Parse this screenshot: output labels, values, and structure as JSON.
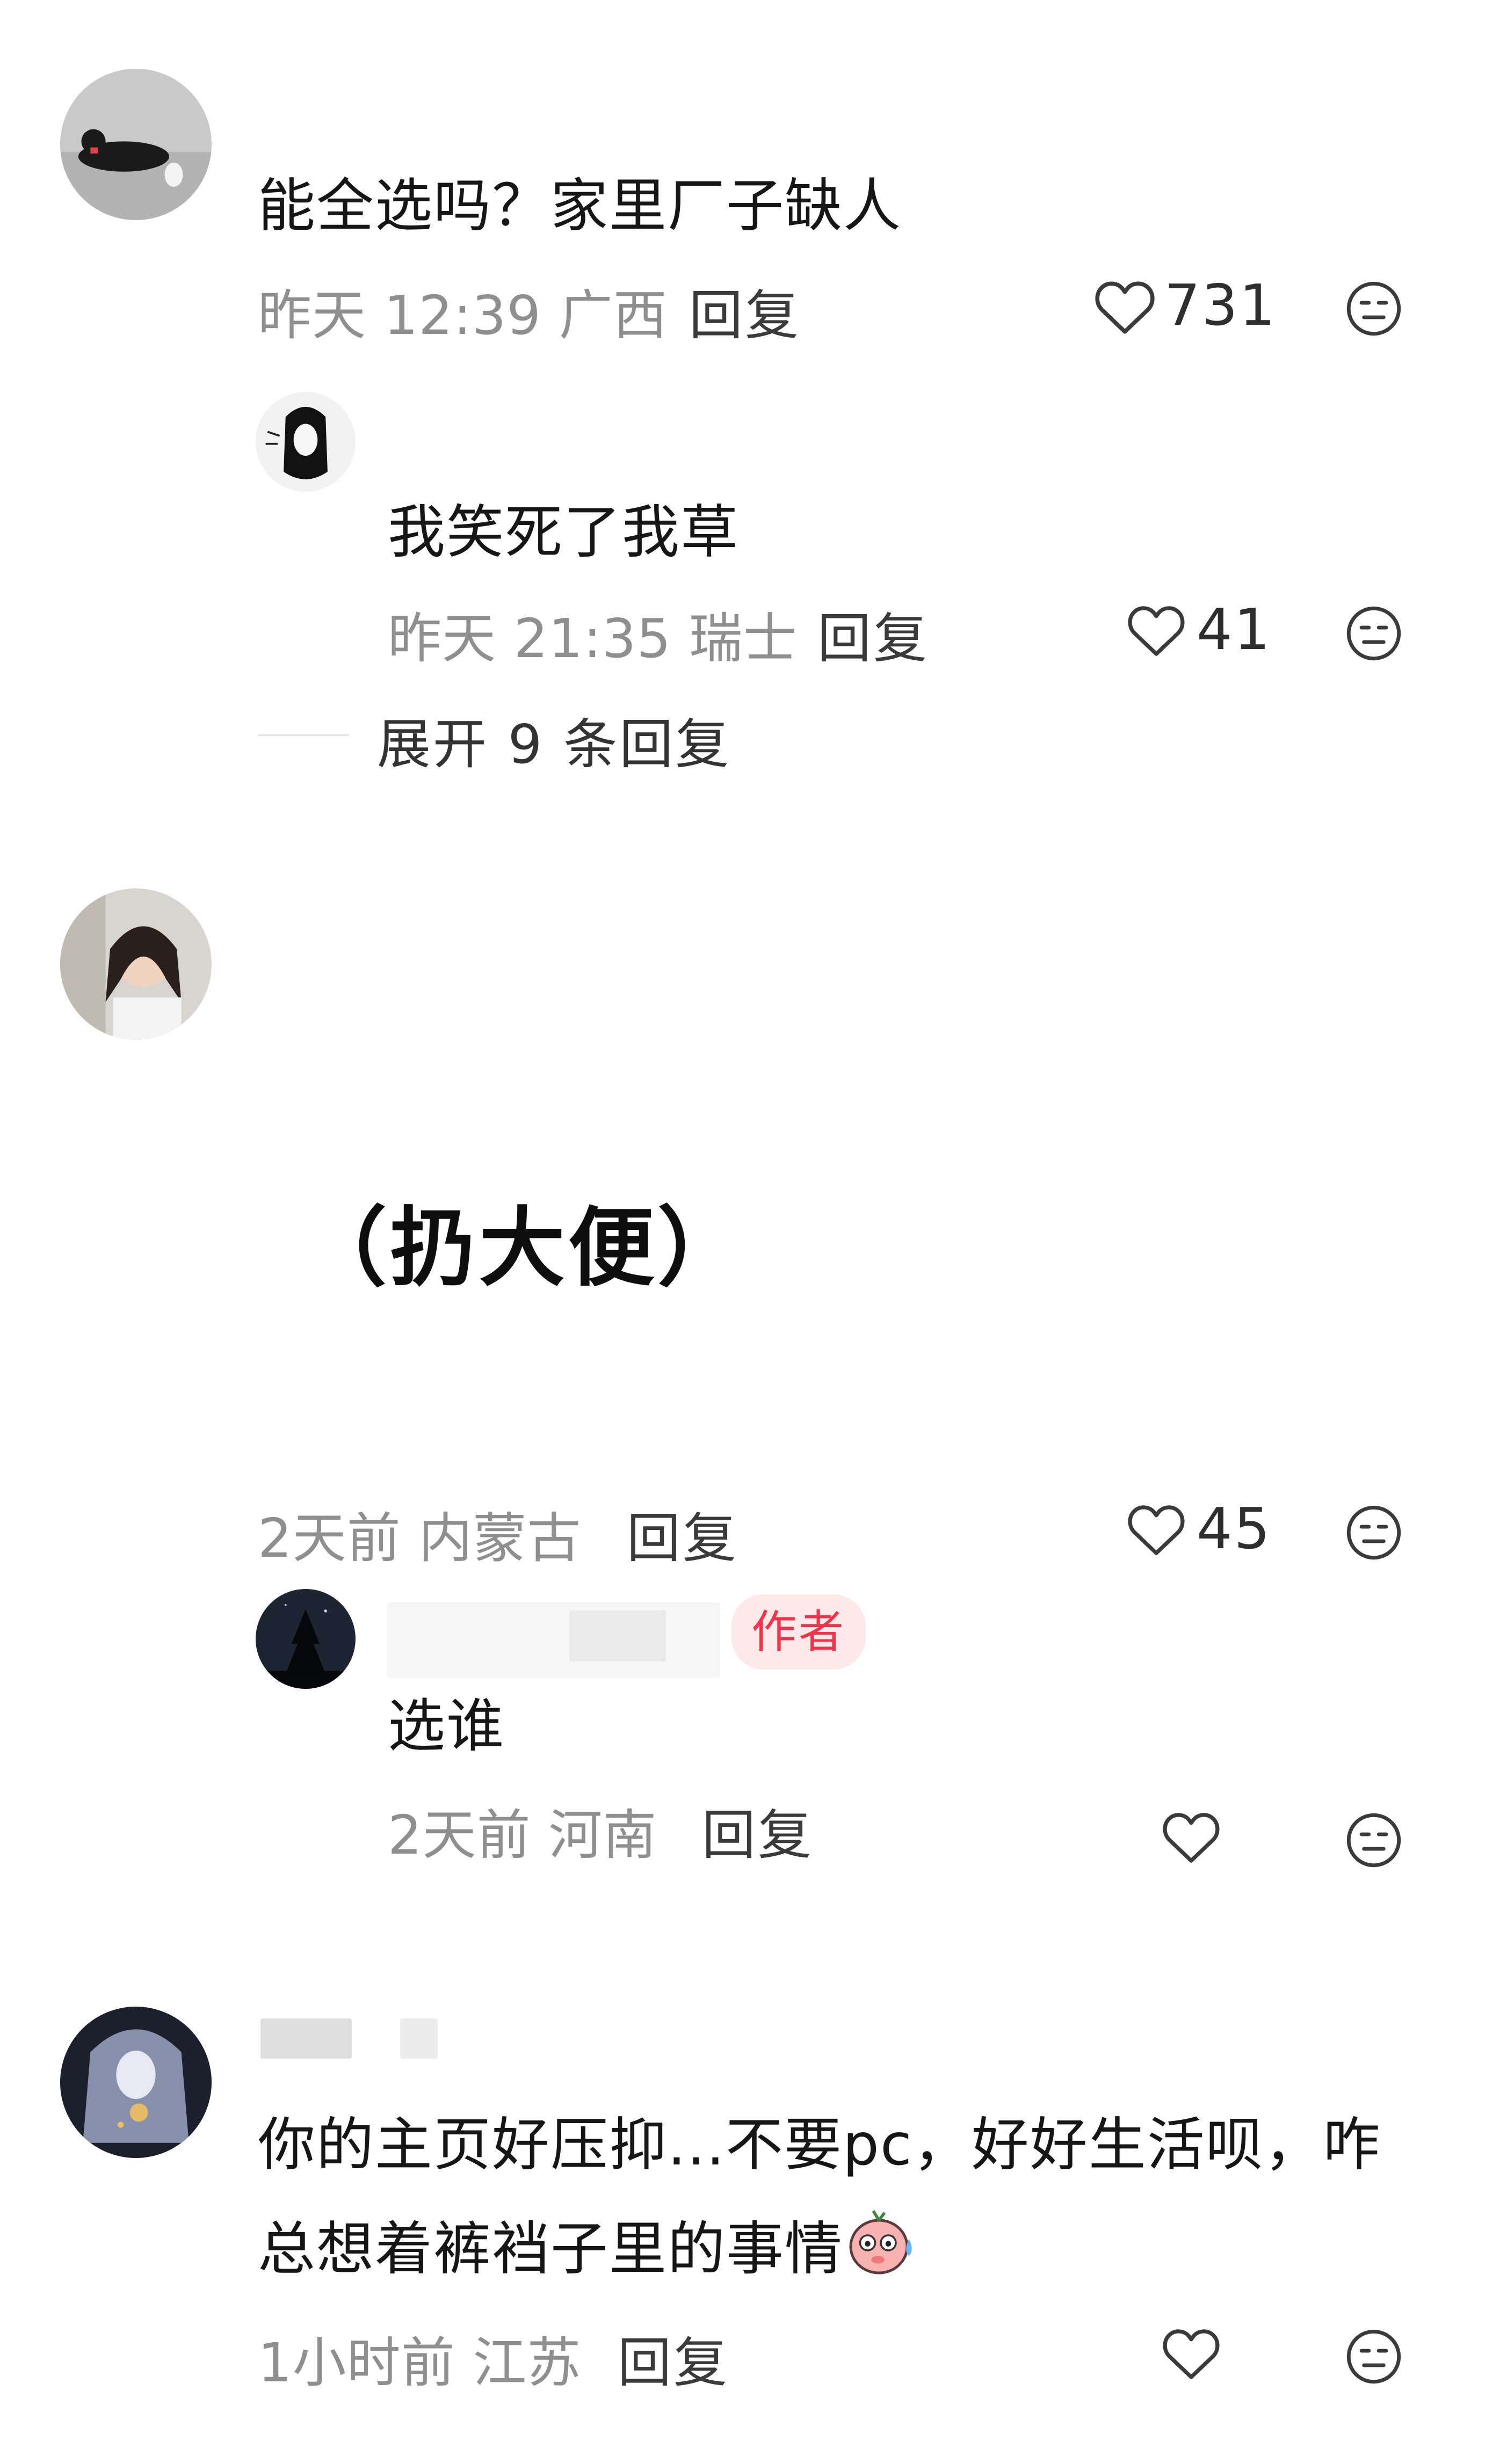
{
  "comments": [
    {
      "text": "能全选吗？家里厂子缺人",
      "time": "昨天 12:39",
      "location": "广西",
      "reply_label": "回复",
      "likes": "731",
      "sub_reply": {
        "text": "我笑死了我草",
        "time": "昨天 21:35",
        "location": "瑞士",
        "reply_label": "回复",
        "likes": "41"
      },
      "expand_label": "展开 9 条回复"
    },
    {
      "sticker_text": "（扔大便）",
      "time": "2天前",
      "location": "内蒙古",
      "reply_label": "回复",
      "likes": "45",
      "sub_reply": {
        "badge": "作者",
        "text": "选谁",
        "time": "2天前",
        "location": "河南",
        "reply_label": "回复",
        "likes": ""
      }
    },
    {
      "text_line1": "你的主页好压抑...不要pc，好好生活呗，咋",
      "text_line2": "总想着裤裆子里的事情",
      "time": "1小时前",
      "location": "江苏",
      "reply_label": "回复",
      "likes": ""
    }
  ],
  "icons": {
    "like": "heart-outline-icon",
    "dislike": "neutral-face-icon"
  },
  "colors": {
    "meta_gray": "#8f8f8f",
    "badge_red": "#f0334a",
    "badge_bg": "#fde9ea"
  }
}
